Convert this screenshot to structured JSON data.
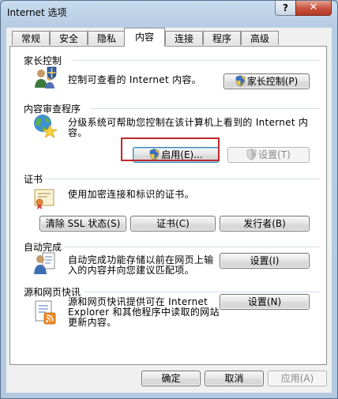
{
  "window": {
    "title": "Internet 选项",
    "help": "?",
    "close": "✕"
  },
  "tabs": [
    {
      "label": "常规"
    },
    {
      "label": "安全"
    },
    {
      "label": "隐私"
    },
    {
      "label": "内容"
    },
    {
      "label": "连接"
    },
    {
      "label": "程序"
    },
    {
      "label": "高级"
    }
  ],
  "active_tab": "内容",
  "parental": {
    "title": "家长控制",
    "desc": "控制可查看的 Internet 内容。",
    "button": "家长控制(P)"
  },
  "advisor": {
    "title": "内容审查程序",
    "desc_line1": "分级系统可帮助您控制在该计算机上看到的 Internet 内",
    "desc_line2": "容。",
    "enable_button": "启用(E)...",
    "settings_button": "设置(T)"
  },
  "certificates": {
    "title": "证书",
    "desc": "使用加密连接和标识的证书。",
    "clear_ssl_button": "清除 SSL 状态(S)",
    "certs_button": "证书(C)",
    "publishers_button": "发行者(B)"
  },
  "autocomplete": {
    "title": "自动完成",
    "desc_line1": "自动完成功能存储以前在网页上输",
    "desc_line2": "入的内容并向您建议匹配项。",
    "settings_button": "设置(I)"
  },
  "feeds": {
    "title": "源和网页快讯",
    "desc_line1": "源和网页快讯提供可在 Internet",
    "desc_line2": "Explorer 和其他程序中读取的网站",
    "desc_line3": "更新内容。",
    "settings_button": "设置(N)"
  },
  "footer": {
    "ok": "确定",
    "cancel": "取消",
    "apply": "应用(A)"
  }
}
